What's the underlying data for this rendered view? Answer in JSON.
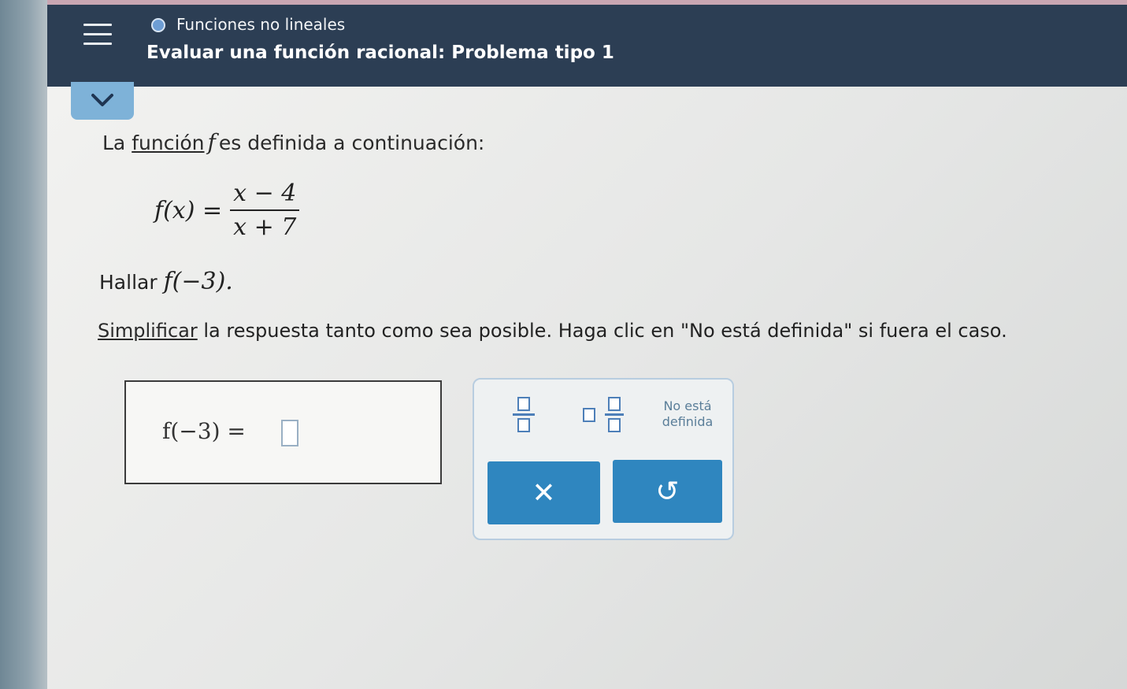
{
  "header": {
    "topic": "Funciones no lineales",
    "lesson": "Evaluar una función racional: Problema tipo 1"
  },
  "problem": {
    "intro_before": "La ",
    "intro_link": "función",
    "intro_var": "f",
    "intro_after": "es definida a continuación:",
    "formula_lhs": "f(x) =",
    "formula_num": "x − 4",
    "formula_den": "x + 7",
    "find_label": "Hallar",
    "find_expr": "f(−3).",
    "instr_link": "Simplificar",
    "instr_text": " la respuesta tanto como sea posible. Haga clic en \"No está definida\" si fuera el caso."
  },
  "answer": {
    "label": "f(−3)  ="
  },
  "toolbox": {
    "undefined_line1": "No está",
    "undefined_line2": "definida",
    "clear_symbol": "✕",
    "undo_symbol": "↺"
  },
  "colors": {
    "header_bg": "#2c3e54",
    "accent": "#2f86bf"
  }
}
